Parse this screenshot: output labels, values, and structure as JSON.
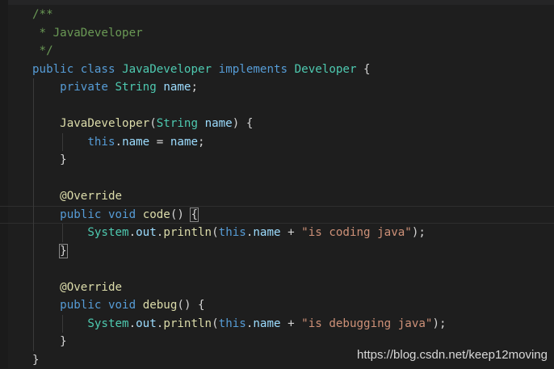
{
  "editor": {
    "language": "Java",
    "watermark": "https://blog.csdn.net/keep12moving",
    "lines": [
      [
        {
          "t": "/**",
          "c": "cm"
        }
      ],
      [
        {
          "t": " * JavaDeveloper",
          "c": "cm"
        }
      ],
      [
        {
          "t": " */",
          "c": "cm"
        }
      ],
      [
        {
          "t": "public",
          "c": "kw"
        },
        {
          "t": " ",
          "c": "pl"
        },
        {
          "t": "class",
          "c": "kw"
        },
        {
          "t": " ",
          "c": "pl"
        },
        {
          "t": "JavaDeveloper",
          "c": "ty"
        },
        {
          "t": " ",
          "c": "pl"
        },
        {
          "t": "implements",
          "c": "kw"
        },
        {
          "t": " ",
          "c": "pl"
        },
        {
          "t": "Developer",
          "c": "ty"
        },
        {
          "t": " {",
          "c": "pl"
        }
      ],
      [
        {
          "t": "    ",
          "c": "pl"
        },
        {
          "t": "private",
          "c": "kw"
        },
        {
          "t": " ",
          "c": "pl"
        },
        {
          "t": "String",
          "c": "ty"
        },
        {
          "t": " ",
          "c": "pl"
        },
        {
          "t": "name",
          "c": "var"
        },
        {
          "t": ";",
          "c": "pl"
        }
      ],
      [],
      [
        {
          "t": "    ",
          "c": "pl"
        },
        {
          "t": "JavaDeveloper",
          "c": "fn"
        },
        {
          "t": "(",
          "c": "pl"
        },
        {
          "t": "String",
          "c": "ty"
        },
        {
          "t": " ",
          "c": "pl"
        },
        {
          "t": "name",
          "c": "var"
        },
        {
          "t": ") {",
          "c": "pl"
        }
      ],
      [
        {
          "t": "        ",
          "c": "pl"
        },
        {
          "t": "this",
          "c": "kw"
        },
        {
          "t": ".",
          "c": "pl"
        },
        {
          "t": "name",
          "c": "var"
        },
        {
          "t": " = ",
          "c": "pl"
        },
        {
          "t": "name",
          "c": "var"
        },
        {
          "t": ";",
          "c": "pl"
        }
      ],
      [
        {
          "t": "    }",
          "c": "pl"
        }
      ],
      [],
      [
        {
          "t": "    ",
          "c": "pl"
        },
        {
          "t": "@Override",
          "c": "fn"
        }
      ],
      [
        {
          "t": "    ",
          "c": "pl"
        },
        {
          "t": "public",
          "c": "kw"
        },
        {
          "t": " ",
          "c": "pl"
        },
        {
          "t": "void",
          "c": "kw"
        },
        {
          "t": " ",
          "c": "pl"
        },
        {
          "t": "code",
          "c": "fn"
        },
        {
          "t": "() ",
          "c": "pl"
        },
        {
          "t": "{",
          "c": "bm"
        }
      ],
      [
        {
          "t": "        ",
          "c": "pl"
        },
        {
          "t": "System",
          "c": "ty"
        },
        {
          "t": ".",
          "c": "pl"
        },
        {
          "t": "out",
          "c": "var"
        },
        {
          "t": ".",
          "c": "pl"
        },
        {
          "t": "println",
          "c": "fn"
        },
        {
          "t": "(",
          "c": "pl"
        },
        {
          "t": "this",
          "c": "kw"
        },
        {
          "t": ".",
          "c": "pl"
        },
        {
          "t": "name",
          "c": "var"
        },
        {
          "t": " + ",
          "c": "pl"
        },
        {
          "t": "\"is coding java\"",
          "c": "str"
        },
        {
          "t": ");",
          "c": "pl"
        }
      ],
      [
        {
          "t": "    ",
          "c": "pl"
        },
        {
          "t": "}",
          "c": "bm"
        }
      ],
      [],
      [
        {
          "t": "    ",
          "c": "pl"
        },
        {
          "t": "@Override",
          "c": "fn"
        }
      ],
      [
        {
          "t": "    ",
          "c": "pl"
        },
        {
          "t": "public",
          "c": "kw"
        },
        {
          "t": " ",
          "c": "pl"
        },
        {
          "t": "void",
          "c": "kw"
        },
        {
          "t": " ",
          "c": "pl"
        },
        {
          "t": "debug",
          "c": "fn"
        },
        {
          "t": "() {",
          "c": "pl"
        }
      ],
      [
        {
          "t": "        ",
          "c": "pl"
        },
        {
          "t": "System",
          "c": "ty"
        },
        {
          "t": ".",
          "c": "pl"
        },
        {
          "t": "out",
          "c": "var"
        },
        {
          "t": ".",
          "c": "pl"
        },
        {
          "t": "println",
          "c": "fn"
        },
        {
          "t": "(",
          "c": "pl"
        },
        {
          "t": "this",
          "c": "kw"
        },
        {
          "t": ".",
          "c": "pl"
        },
        {
          "t": "name",
          "c": "var"
        },
        {
          "t": " + ",
          "c": "pl"
        },
        {
          "t": "\"is debugging java\"",
          "c": "str"
        },
        {
          "t": ");",
          "c": "pl"
        }
      ],
      [
        {
          "t": "    }",
          "c": "pl"
        }
      ],
      [
        {
          "t": "}",
          "c": "pl"
        }
      ]
    ],
    "current_line": 11
  }
}
